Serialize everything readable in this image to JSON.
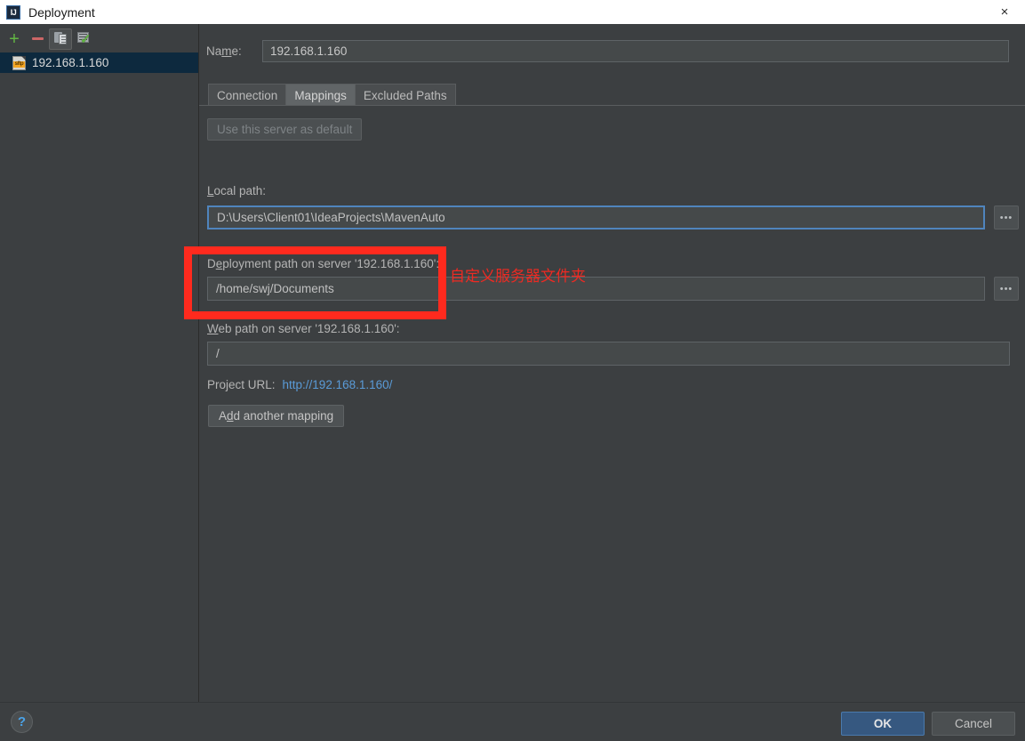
{
  "window": {
    "title": "Deployment",
    "icon": "IJ",
    "close_icon": "×"
  },
  "sidebar": {
    "toolbar": [
      {
        "name": "add",
        "icon": "plus-icon",
        "label": "+"
      },
      {
        "name": "remove",
        "icon": "minus-icon",
        "label": "−"
      },
      {
        "name": "copy",
        "icon": "copy-icon",
        "label": ""
      },
      {
        "name": "set-default",
        "icon": "server-check-icon",
        "label": ""
      }
    ],
    "servers": [
      {
        "label": "192.168.1.160",
        "icon": "sftp-icon",
        "badge": "sftp",
        "selected": true
      }
    ]
  },
  "form": {
    "name_label": "Na",
    "name_label_underlined": "m",
    "name_label_tail": "e:",
    "name_value": "192.168.1.160",
    "tabs": [
      {
        "label": "Connection",
        "active": false
      },
      {
        "label": "Mappings",
        "active": true
      },
      {
        "label": "Excluded Paths",
        "active": false
      }
    ],
    "use_default_button": "Use this server as default",
    "local_path_label_head": "",
    "local_path_label_underlined": "L",
    "local_path_label_tail": "ocal path:",
    "local_path_value": "D:\\Users\\Client01\\IdeaProjects\\MavenAuto",
    "deployment_path_label_head": "D",
    "deployment_path_label_underlined": "e",
    "deployment_path_label_tail": "ployment path on server '192.168.1.160':",
    "deployment_path_value": "/home/swj/Documents",
    "web_path_label_head": "",
    "web_path_label_underlined": "W",
    "web_path_label_tail": "eb path on server '192.168.1.160':",
    "web_path_value": "/",
    "project_url_label": "Project URL:",
    "project_url_value": "http://192.168.1.160/",
    "add_mapping_head": "A",
    "add_mapping_underlined": "d",
    "add_mapping_tail": "d another mapping",
    "browse_button_label": "•••"
  },
  "annotations": {
    "note_text": "自定义服务器文件夹",
    "highlight_color": "#ff2a1e"
  },
  "footer": {
    "help_label": "?",
    "ok_label": "OK",
    "cancel_label": "Cancel"
  }
}
